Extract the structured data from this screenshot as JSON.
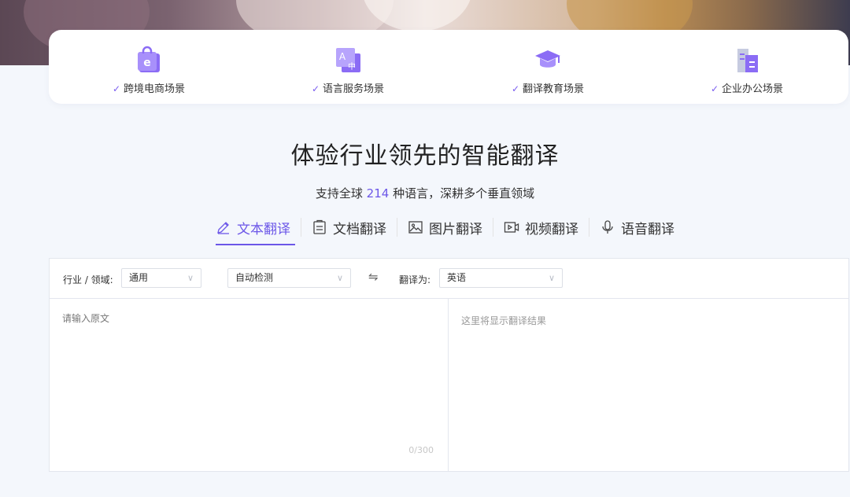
{
  "scenes": [
    {
      "label": "跨境电商场景",
      "icon": "shopping-bag-icon"
    },
    {
      "label": "语言服务场景",
      "icon": "translate-icon"
    },
    {
      "label": "翻译教育场景",
      "icon": "graduation-cap-icon"
    },
    {
      "label": "企业办公场景",
      "icon": "office-building-icon"
    }
  ],
  "check_mark": "✓",
  "headline": "体验行业领先的智能翻译",
  "subline": {
    "before": "支持全球",
    "count": "214",
    "after": "种语言，深耕多个垂直领域"
  },
  "tabs": [
    {
      "label": "文本翻译",
      "icon": "pencil-icon",
      "active": true
    },
    {
      "label": "文档翻译",
      "icon": "document-icon",
      "active": false
    },
    {
      "label": "图片翻译",
      "icon": "image-icon",
      "active": false
    },
    {
      "label": "视频翻译",
      "icon": "video-icon",
      "active": false
    },
    {
      "label": "语音翻译",
      "icon": "microphone-icon",
      "active": false
    }
  ],
  "toolbar": {
    "domain_label": "行业 / 领域:",
    "domain_value": "通用",
    "source_lang": "自动检测",
    "swap_glyph": "⇋",
    "target_label": "翻译为:",
    "target_lang": "英语"
  },
  "source": {
    "placeholder": "请输入原文",
    "value": "",
    "counter": "0/300"
  },
  "result": {
    "placeholder": "这里将显示翻译结果"
  },
  "colors": {
    "accent": "#6c57e8",
    "icon_purple": "#8b6cf5"
  }
}
